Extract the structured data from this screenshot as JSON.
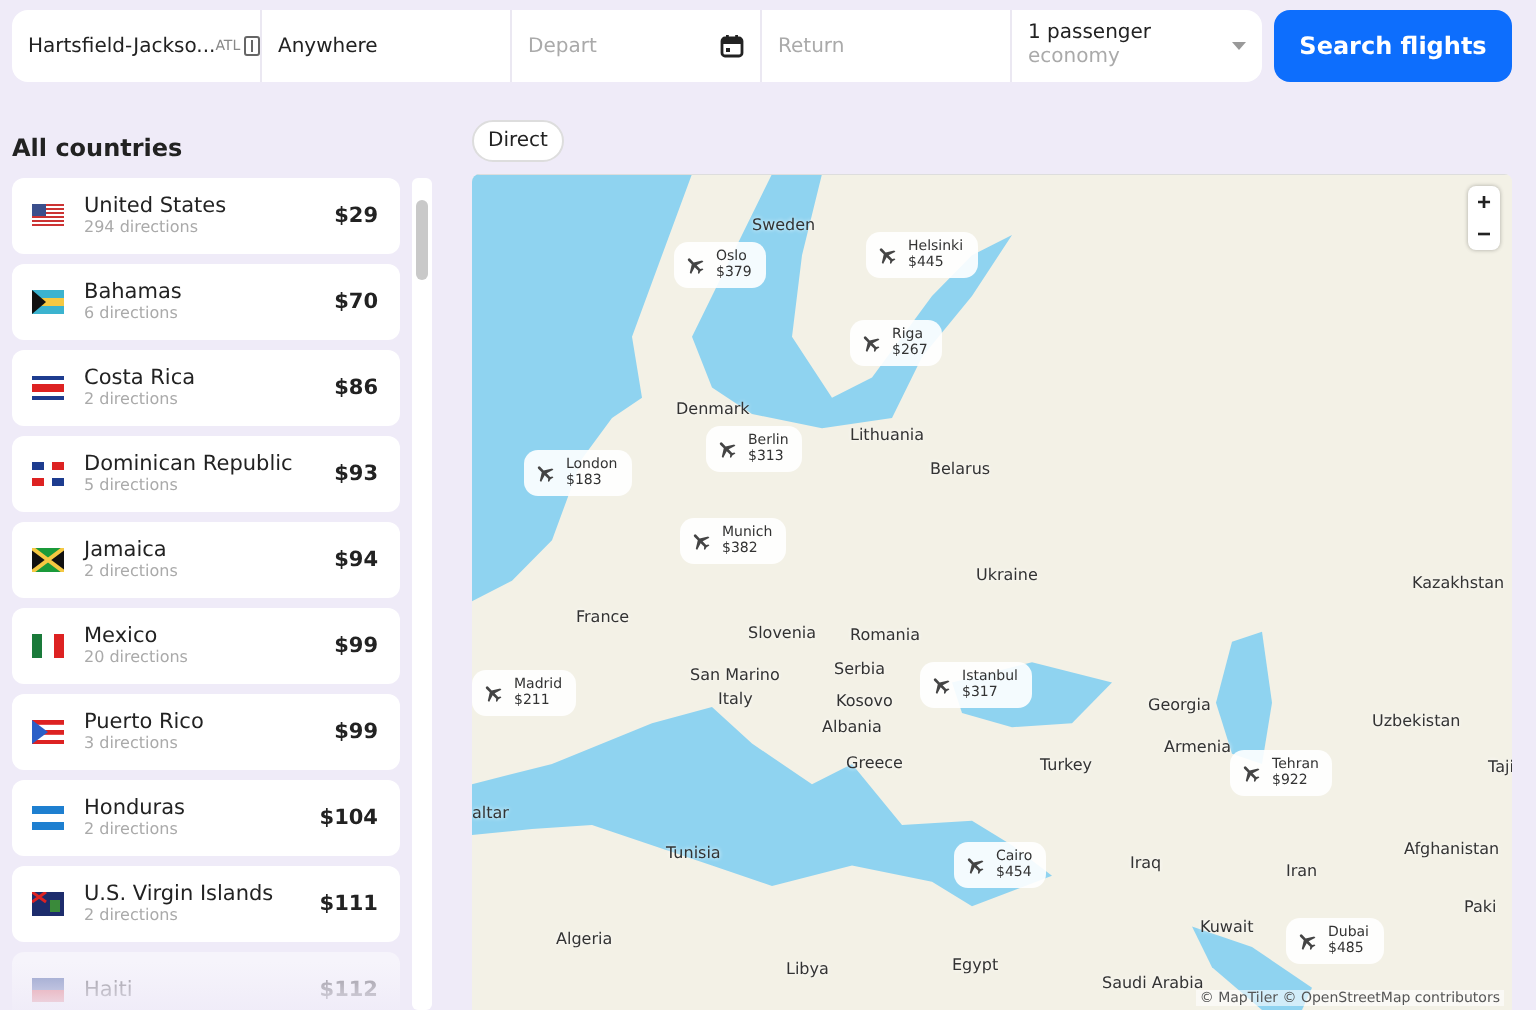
{
  "search": {
    "origin": {
      "value": "Hartsfield-Jackso...",
      "code": "ATL"
    },
    "destination": {
      "value": "Anywhere"
    },
    "depart": {
      "placeholder": "Depart"
    },
    "return": {
      "placeholder": "Return"
    },
    "passengers": {
      "value": "1 passenger",
      "cabin": "economy"
    },
    "button": "Search flights"
  },
  "sidebar": {
    "title": "All countries",
    "countries": [
      {
        "name": "United States",
        "directions": "294 directions",
        "price": "$29"
      },
      {
        "name": "Bahamas",
        "directions": "6 directions",
        "price": "$70"
      },
      {
        "name": "Costa Rica",
        "directions": "2 directions",
        "price": "$86"
      },
      {
        "name": "Dominican Republic",
        "directions": "5 directions",
        "price": "$93"
      },
      {
        "name": "Jamaica",
        "directions": "2 directions",
        "price": "$94"
      },
      {
        "name": "Mexico",
        "directions": "20 directions",
        "price": "$99"
      },
      {
        "name": "Puerto Rico",
        "directions": "3 directions",
        "price": "$99"
      },
      {
        "name": "Honduras",
        "directions": "2 directions",
        "price": "$104"
      },
      {
        "name": "U.S. Virgin Islands",
        "directions": "2 directions",
        "price": "$111"
      },
      {
        "name": "Haiti",
        "price": "$112"
      }
    ]
  },
  "filters": [
    {
      "label": "Direct"
    }
  ],
  "map": {
    "zoom_in": "+",
    "zoom_out": "−",
    "attribution": "© MapTiler © OpenStreetMap contributors",
    "labels": [
      "Sweden",
      "Denmark",
      "Lithuania",
      "Belarus",
      "Ukraine",
      "France",
      "Slovenia",
      "Romania",
      "San Marino",
      "Serbia",
      "Italy",
      "Kosovo",
      "Albania",
      "Greece",
      "Turkey",
      "Georgia",
      "Armenia",
      "Kazakhstan",
      "Uzbekistan",
      "Taji",
      "Afghanistan",
      "Paki",
      "Iran",
      "Iraq",
      "Kuwait",
      "Tunisia",
      "Algeria",
      "Libya",
      "Egypt",
      "altar",
      "Saudi Arabia"
    ],
    "pins": [
      {
        "city": "Oslo",
        "price": "$379"
      },
      {
        "city": "Helsinki",
        "price": "$445"
      },
      {
        "city": "Riga",
        "price": "$267"
      },
      {
        "city": "Berlin",
        "price": "$313"
      },
      {
        "city": "London",
        "price": "$183"
      },
      {
        "city": "Munich",
        "price": "$382"
      },
      {
        "city": "Madrid",
        "price": "$211"
      },
      {
        "city": "Istanbul",
        "price": "$317"
      },
      {
        "city": "Cairo",
        "price": "$454"
      },
      {
        "city": "Tehran",
        "price": "$922"
      },
      {
        "city": "Dubai",
        "price": "$485"
      }
    ]
  }
}
